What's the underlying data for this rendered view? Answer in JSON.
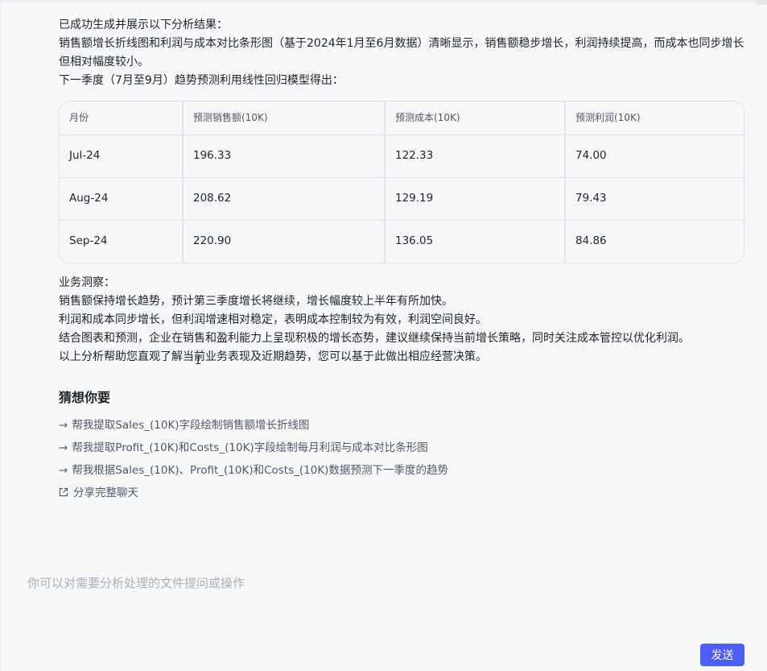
{
  "result": {
    "line1": "已成功生成并展示以下分析结果：",
    "line2": "销售额增长折线图和利润与成本对比条形图（基于2024年1月至6月数据）清晰显示，销售额稳步增长，利润持续提高，而成本也同步增长但相对幅度较小。",
    "line3": "下一季度（7月至9月）趋势预测利用线性回归模型得出："
  },
  "table": {
    "headers": [
      "月份",
      "预测销售额(10K)",
      "预测成本(10K)",
      "预测利润(10K)"
    ],
    "rows": [
      [
        "Jul-24",
        "196.33",
        "122.33",
        "74.00"
      ],
      [
        "Aug-24",
        "208.62",
        "129.19",
        "79.43"
      ],
      [
        "Sep-24",
        "220.90",
        "136.05",
        "84.86"
      ]
    ]
  },
  "insights": {
    "heading": "业务洞察：",
    "items": [
      "销售额保持增长趋势，预计第三季度增长将继续，增长幅度较上半年有所加快。",
      "利润和成本同步增长，但利润增速相对稳定，表明成本控制较为有效，利润空间良好。",
      "结合图表和预测，企业在销售和盈利能力上呈现积极的增长态势，建议继续保持当前增长策略，同时关注成本管控以优化利润。",
      "以上分析帮助您直观了解当前业务表现及近期趋势，您可以基于此做出相应经营决策。"
    ]
  },
  "guess": {
    "title": "猜想你要",
    "arrow": "→",
    "suggestions": [
      "帮我提取Sales_(10K)字段绘制销售额增长折线图",
      "帮我提取Profit_(10K)和Costs_(10K)字段绘制每月利润与成本对比条形图",
      "帮我根据Sales_(10K)、Profit_(10K)和Costs_(10K)数据预测下一季度的趋势"
    ],
    "share": "分享完整聊天"
  },
  "input": {
    "placeholder": "你可以对需要分析处理的文件提问或操作"
  },
  "send_label": "发送",
  "colors": {
    "accent": "#4d5dfa",
    "background": "#f7f8fa"
  }
}
